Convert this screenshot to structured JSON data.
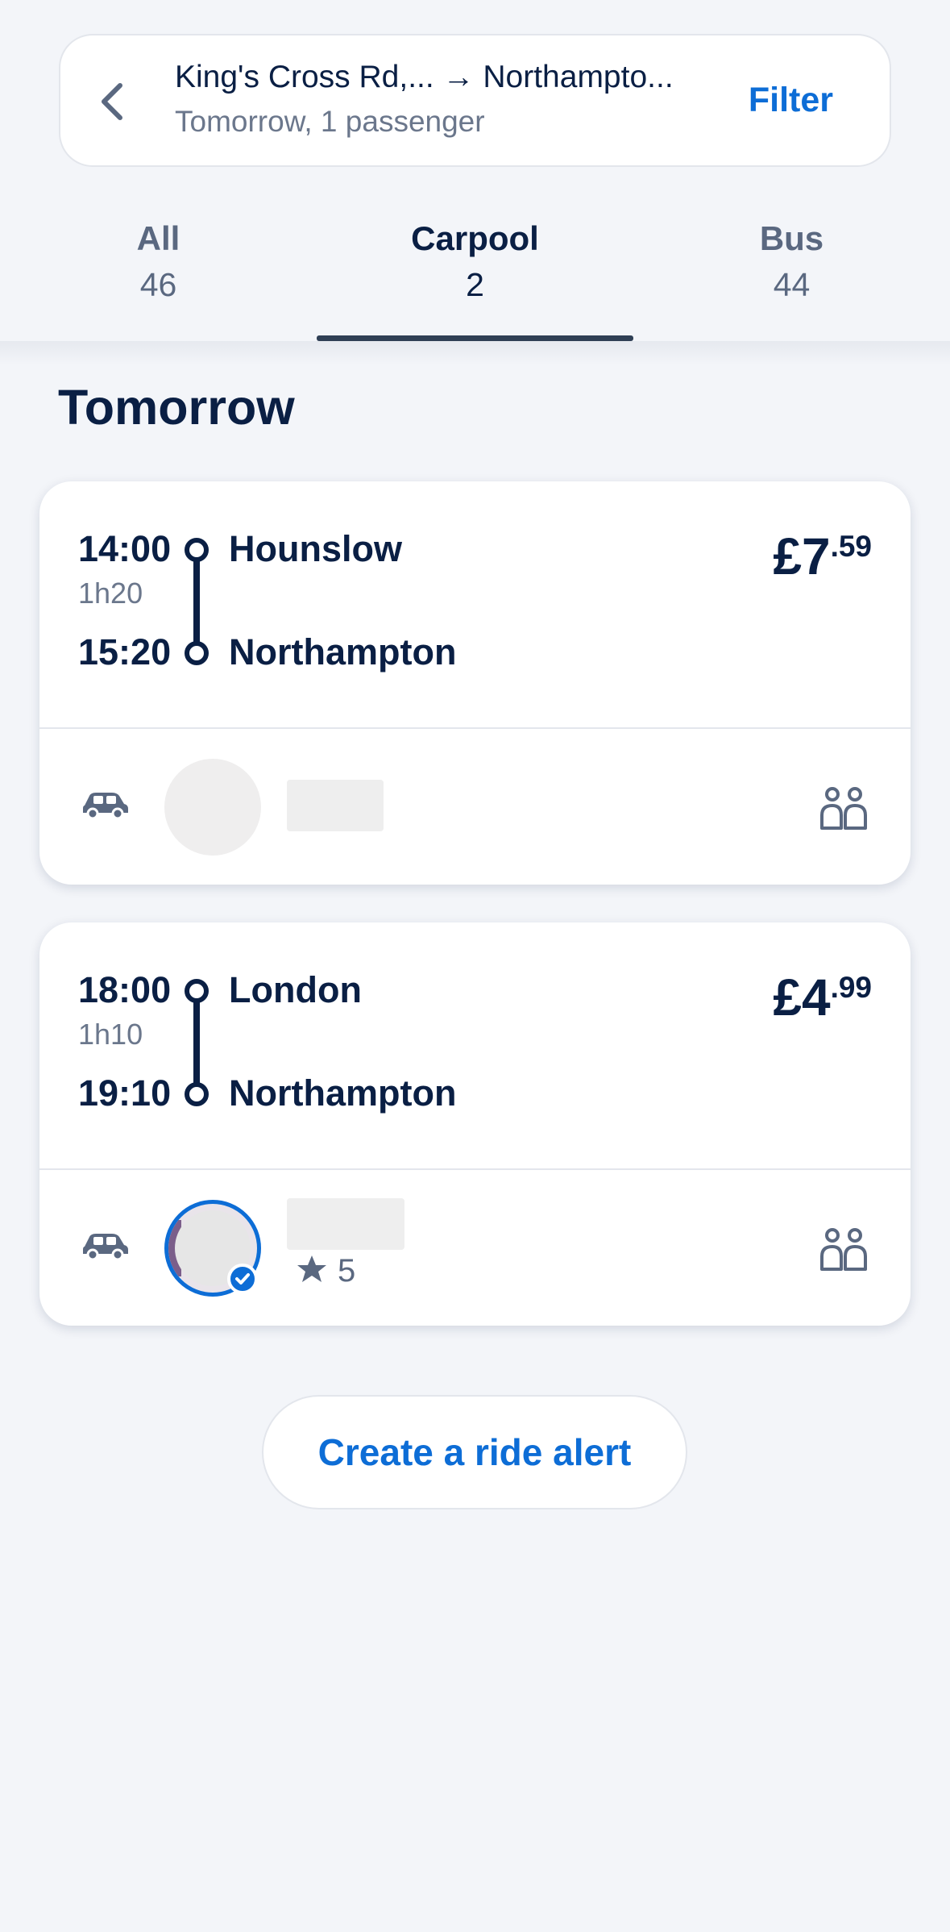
{
  "header": {
    "route": "King's Cross Rd,... → Northampto...",
    "subtitle": "Tomorrow, 1 passenger",
    "filter_label": "Filter"
  },
  "tabs": [
    {
      "label": "All",
      "count": "46",
      "active": false
    },
    {
      "label": "Carpool",
      "count": "2",
      "active": true
    },
    {
      "label": "Bus",
      "count": "44",
      "active": false
    }
  ],
  "section_title": "Tomorrow",
  "rides": [
    {
      "departure_time": "14:00",
      "duration": "1h20",
      "arrival_time": "15:20",
      "from": "Hounslow",
      "to": "Northampton",
      "price_main": "£7",
      "price_cents": ".59",
      "icons": [
        "car-icon",
        "avatar",
        "passengers-icon"
      ]
    },
    {
      "departure_time": "18:00",
      "duration": "1h10",
      "arrival_time": "19:10",
      "from": "London",
      "to": "Northampton",
      "price_main": "£4",
      "price_cents": ".99",
      "rating": "5",
      "verified": true,
      "icons": [
        "car-icon",
        "avatar",
        "verified-icon",
        "star-icon",
        "passengers-icon"
      ]
    }
  ],
  "alert_button": "Create a ride alert",
  "colors": {
    "accent": "#0d6dd6",
    "text": "#0a1f44",
    "muted": "#6b778c",
    "background": "#f3f5f9"
  }
}
